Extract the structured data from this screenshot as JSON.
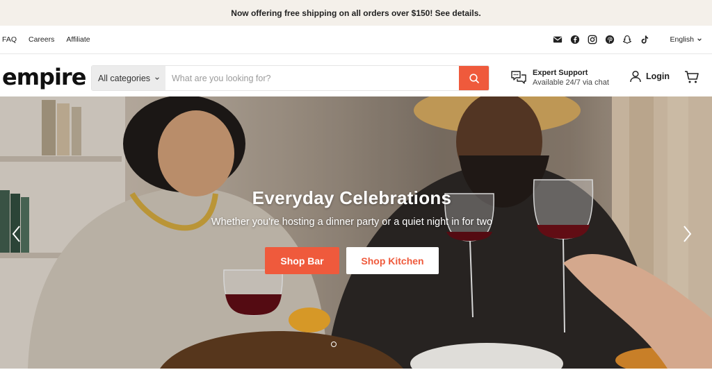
{
  "announcement": {
    "text": "Now offering free shipping on all orders over $150! See details."
  },
  "utility": {
    "links": [
      "FAQ",
      "Careers",
      "Affiliate"
    ],
    "social_icons": [
      "email-icon",
      "facebook-icon",
      "instagram-icon",
      "pinterest-icon",
      "snapchat-icon",
      "tiktok-icon"
    ],
    "language": "English"
  },
  "header": {
    "logo": "empire",
    "search": {
      "category": "All categories",
      "placeholder": "What are you looking for?",
      "button_icon": "search-icon"
    },
    "support": {
      "title": "Expert Support",
      "subtitle": "Available 24/7 via chat"
    },
    "login_label": "Login",
    "cart_icon": "cart-icon"
  },
  "hero": {
    "title": "Everyday Celebrations",
    "subtitle": "Whether you're hosting a dinner party or a quiet night in for two",
    "primary_button": "Shop Bar",
    "secondary_button": "Shop Kitchen",
    "slide_count": 1,
    "active_slide": 1
  },
  "colors": {
    "accent": "#ef5a3c",
    "announcement_bg": "#f4f0ea",
    "text": "#222222"
  }
}
